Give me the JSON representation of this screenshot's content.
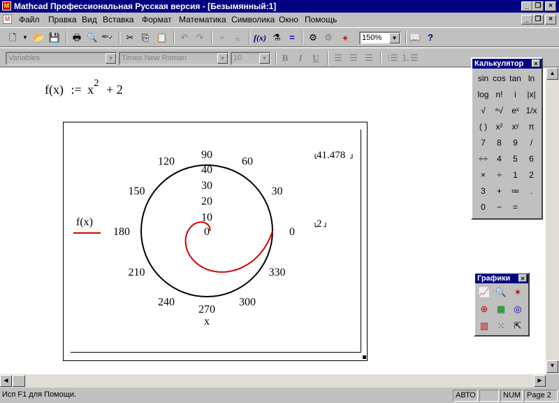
{
  "window": {
    "title": "Mathcad Профессиональная Русская версия - [Безымянный:1]",
    "menu": [
      "Файл",
      "Правка",
      "Вид",
      "Вставка",
      "Формат",
      "Математика",
      "Символика",
      "Окно",
      "Помощь"
    ]
  },
  "toolbar": {
    "zoom": "150%",
    "style": "Variables",
    "font": "Times New Roman",
    "size": "10",
    "bold": "B",
    "italic": "I",
    "underline": "U"
  },
  "worksheet": {
    "formula_lhs": "f(x)",
    "formula_assign": ":=",
    "formula_base": "x",
    "formula_exp": "2",
    "formula_plus": "+ 2",
    "plot": {
      "angle_labels": [
        "90",
        "60",
        "30",
        "0",
        "330",
        "300",
        "270",
        "240",
        "210",
        "180",
        "150",
        "120"
      ],
      "radial_labels": [
        "10",
        "20",
        "30",
        "40"
      ],
      "center_label": "0",
      "upper_range": "41.478",
      "lower_range": "2",
      "legend_label": "f(x)",
      "xaxis_label": "x"
    }
  },
  "chart_data": {
    "type": "polar",
    "title": "",
    "series": [
      {
        "name": "f(x)",
        "expression": "x^2 + 2",
        "color": "#d40000"
      }
    ],
    "r_range": [
      2,
      41.478
    ],
    "radial_ticks": [
      10,
      20,
      30,
      40
    ],
    "angle_ticks_deg": [
      0,
      30,
      60,
      90,
      120,
      150,
      180,
      210,
      240,
      270,
      300,
      330
    ],
    "theta_range_rad": [
      0,
      6.2832
    ]
  },
  "calculator": {
    "title": "Калькулятор",
    "buttons": [
      "sin",
      "cos",
      "tan",
      "ln",
      "log",
      "n!",
      "i",
      "|x|",
      "√",
      "ⁿ√",
      "eˣ",
      "1/x",
      "( )",
      "x²",
      "xʸ",
      "π",
      "7",
      "8",
      "9",
      "/",
      "÷÷",
      "4",
      "5",
      "6",
      "×",
      "÷",
      "1",
      "2",
      "3",
      "+",
      "≔",
      ".",
      "0",
      "−",
      "="
    ]
  },
  "graphs": {
    "title": "Графики"
  },
  "status": {
    "help": "Исп F1 для Помощи.",
    "mode": "АВТО",
    "num": "NUM",
    "page": "Page 2"
  }
}
